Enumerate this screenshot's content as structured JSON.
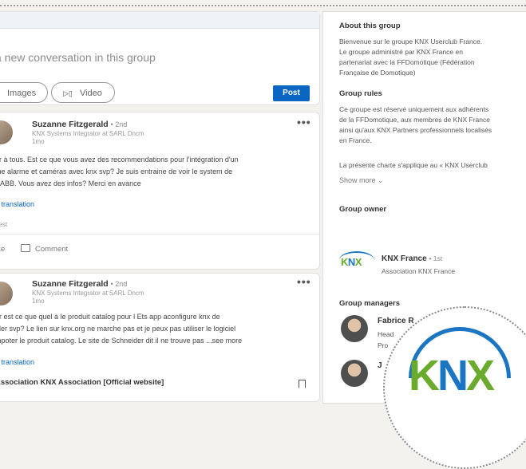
{
  "composer": {
    "placeholder": "a new conversation in this group",
    "images_label": "Images",
    "video_label": "Video",
    "post_label": "Post"
  },
  "posts": [
    {
      "author": "Suzanne Fitzgerald",
      "time": "• 2nd",
      "headline": "KNX Systems Integrator at SARL Dncm",
      "age": "1mo",
      "lines": [
        "ur à tous. Est ce que vous avez des recommendations pour l'intégration d'un",
        "me alarme et caméras avec knx svp? Je suis entraine de voir le system de",
        "il ABB. Vous avez des infos? Merci en avance"
      ],
      "see_translation": "e translation",
      "reactions": "hest",
      "like_label": "ike",
      "comment_label": "Comment"
    },
    {
      "author": "Suzanne Fitzgerald",
      "time": "• 2nd",
      "headline": "KNX Systems Integrator at SARL Dncm",
      "age": "1mo",
      "lines": [
        "ur est ce que quel à le produit catalog pour l Ets app aconfigure knx de",
        "ider svp? Le lien sur knx.org ne marche pas et je peux pas utiliser le logiciel",
        "mpoter le produit catalog. Le site de Schneider dit il ne trouve pas ...see more"
      ],
      "see_translation": "e translation",
      "link_title": "Association KNX Association [Official website]"
    }
  ],
  "sidebar": {
    "about_title": "About this group",
    "about_lines": [
      "Bienvenue sur le groupe KNX Userclub France.",
      "Le groupe administré par KNX France en",
      "partenariat avec la FFDomotique (Fédération",
      "Française de Domotique)"
    ],
    "rules_title": "Group rules",
    "rules_lines": [
      "Ce groupe est réservé uniquement aux adhérents",
      "de la FFDomotique, aux membres de KNX France",
      "ainsi qu'aux KNX Partners professionnels localisés",
      "en France."
    ],
    "charter_line": "La présente charte s'applique au « KNX Userclub",
    "show_more": "Show more",
    "owner_title": "Group owner",
    "owner_name": "KNX France",
    "owner_degree": "• 1st",
    "owner_sub": "Association KNX France",
    "managers_title": "Group managers",
    "managers": [
      {
        "name": "Fabrice R",
        "sub_lines": [
          "Head",
          "Pro"
        ]
      },
      {
        "name": "J",
        "sub_lines": []
      }
    ]
  },
  "logo": {
    "k": "K",
    "n": "N",
    "x": "X"
  },
  "colors": {
    "accent": "#0a66c2",
    "knx_green": "#6aab2e",
    "knx_blue": "#1a76c3"
  }
}
